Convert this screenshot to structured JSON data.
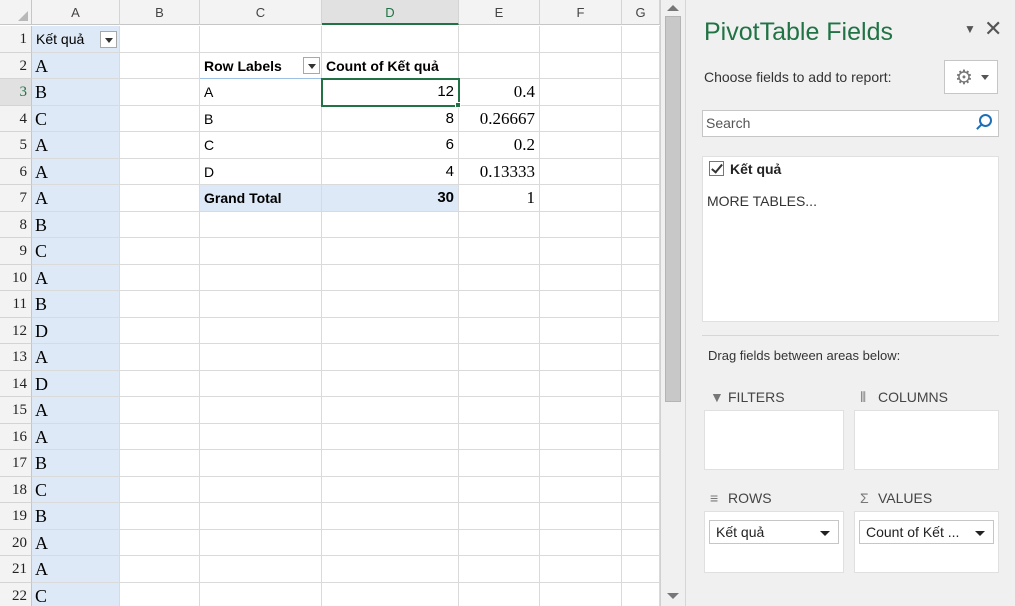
{
  "grid": {
    "column_headers": [
      "A",
      "B",
      "C",
      "D",
      "E",
      "F",
      "G"
    ],
    "row_numbers": [
      "1",
      "2",
      "3",
      "4",
      "5",
      "6",
      "7",
      "8",
      "9",
      "10",
      "11",
      "12",
      "13",
      "14",
      "15",
      "16",
      "17",
      "18",
      "19",
      "20",
      "21",
      "22"
    ],
    "column_a_header": "Kết quả",
    "column_a_values": [
      "A",
      "B",
      "C",
      "A",
      "A",
      "A",
      "B",
      "C",
      "A",
      "B",
      "D",
      "A",
      "D",
      "A",
      "A",
      "B",
      "C",
      "B",
      "A",
      "A",
      "C"
    ],
    "pivot": {
      "row_labels_header": "Row Labels",
      "count_header": "Count of Kết quả",
      "rows": [
        {
          "label": "A",
          "count": "12",
          "ratio": "0.4"
        },
        {
          "label": "B",
          "count": "8",
          "ratio": "0.26667"
        },
        {
          "label": "C",
          "count": "6",
          "ratio": "0.2"
        },
        {
          "label": "D",
          "count": "4",
          "ratio": "0.13333"
        }
      ],
      "grand_total_label": "Grand Total",
      "grand_total_count": "30",
      "grand_total_ratio": "1"
    },
    "active_cell": "D3"
  },
  "pane": {
    "title": "PivotTable Fields",
    "choose_text": "Choose fields to add to report:",
    "search_placeholder": "Search",
    "fields": [
      {
        "label": "Kết quả",
        "checked": true
      }
    ],
    "more_tables": "MORE TABLES...",
    "drag_text": "Drag fields between areas below:",
    "areas": {
      "filters": {
        "label": "FILTERS",
        "icon": "filter-icon"
      },
      "columns": {
        "label": "COLUMNS",
        "icon": "columns-icon"
      },
      "rows": {
        "label": "ROWS",
        "icon": "rows-icon",
        "item": "Kết quả"
      },
      "values": {
        "label": "VALUES",
        "icon": "sigma-icon",
        "item": "Count of Kết ..."
      }
    }
  },
  "colors": {
    "accent": "#217346",
    "band": "#dde9f6"
  }
}
